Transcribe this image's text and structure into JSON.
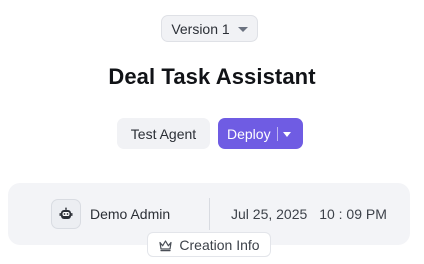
{
  "version_selector": {
    "label": "Version 1"
  },
  "agent": {
    "title": "Deal Task Assistant"
  },
  "actions": {
    "test_label": "Test Agent",
    "deploy_label": "Deploy"
  },
  "creation": {
    "owner": "Demo Admin",
    "date": "Jul 25, 2025",
    "time": "10 : 09 PM",
    "tag_label": "Creation Info"
  },
  "colors": {
    "accent": "#6f5ce3",
    "surface": "#f3f4f7"
  },
  "icons": {
    "avatar": "robot-icon",
    "tag": "crown-icon"
  }
}
